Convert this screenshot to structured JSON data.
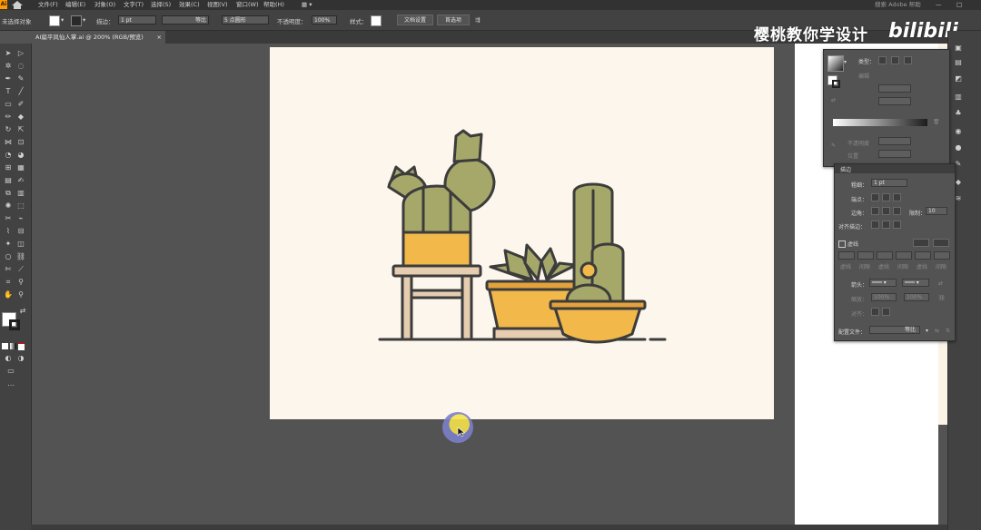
{
  "app": {
    "logo": "Ai",
    "home_icon": "home-icon"
  },
  "menu": {
    "items": [
      "文件(F)",
      "编辑(E)",
      "对象(O)",
      "文字(T)",
      "选择(S)",
      "效果(C)",
      "视图(V)",
      "窗口(W)",
      "帮助(H)"
    ],
    "right_search": "搜索 Adobe 帮助"
  },
  "control_bar": {
    "selection_label": "未选择对象",
    "fill_color": "#ffffff",
    "stroke_label": "描边：",
    "stroke_weight": "1 pt",
    "stroke_profile": "等比",
    "brush": "5 点圆形",
    "opacity_label": "不透明度：",
    "opacity_value": "100%",
    "style_label": "样式：",
    "doc_setup_button": "文档设置",
    "prefs_button": "首选项"
  },
  "document_tab": {
    "title": "AI扁平风仙人掌.ai @ 200% (RGB/预览)",
    "close": "×"
  },
  "watermark": {
    "text": "樱桃教你学设计",
    "brand": "bilibili"
  },
  "color_panel": {
    "type_label": "类型：",
    "edit_label": "编辑",
    "mode_label": "不透明度",
    "location_label": "位置"
  },
  "stroke_panel": {
    "tab": "描边",
    "weight_label": "粗细：",
    "weight_value": "1 pt",
    "cap_label": "端点：",
    "corner_label": "边角：",
    "limit_label": "限制：",
    "limit_value": "10",
    "align_label": "对齐描边：",
    "dashed_label": "虚线",
    "dash_cells": [
      "虚线",
      "间隙",
      "虚线",
      "间隙",
      "虚线",
      "间隙"
    ],
    "arrow_label": "箭头：",
    "scale_label": "缩放：",
    "scale_value_1": "100%",
    "scale_value_2": "100%",
    "align_arrow_label": "对齐：",
    "profile_label": "配置文件：",
    "profile_value": "等比"
  },
  "colors": {
    "canvas_bg": "#535353",
    "artboard": "#fdf6ec",
    "panel": "#535353",
    "cactus_green": "#a6a86a",
    "pot_orange": "#f2b84a",
    "outline": "#3c3c3c",
    "stool": "#e6cdb0"
  }
}
